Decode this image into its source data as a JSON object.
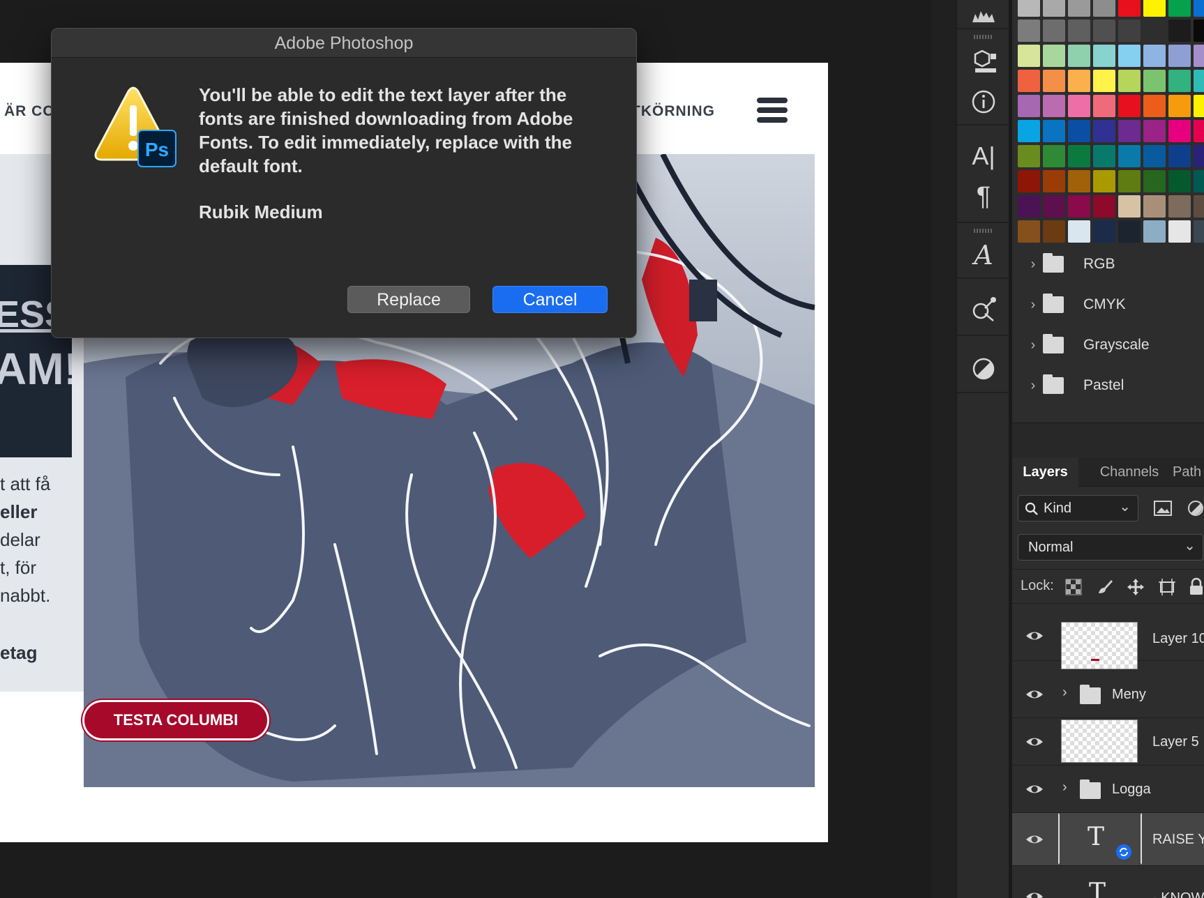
{
  "dialog": {
    "title": "Adobe Photoshop",
    "message": "You'll be able to edit the text layer after the fonts are finished downloading from Adobe Fonts. To edit immediately, replace with the default font.",
    "font_name": "Rubik Medium",
    "replace_label": "Replace",
    "cancel_label": "Cancel",
    "icon_badge": "Ps"
  },
  "document": {
    "nav_left": "ÄR CO",
    "nav_right": "TKÖRNING",
    "banner_line1": "ESS",
    "banner_line2": "AM!",
    "body_lines": [
      "t att få",
      "eller",
      "delar",
      "t, för",
      "nabbt.",
      "etag"
    ],
    "cta_label": "TESTA COLUMBI"
  },
  "swatch_folders": [
    "RGB",
    "CMYK",
    "Grayscale",
    "Pastel"
  ],
  "layers_panel": {
    "tabs": [
      "Layers",
      "Channels",
      "Path"
    ],
    "filter_label": "Kind",
    "blend_mode": "Normal",
    "lock_label": "Lock:",
    "layers": [
      {
        "name": "Layer 10",
        "kind": "pixel"
      },
      {
        "name": "Meny",
        "kind": "group"
      },
      {
        "name": "Layer 5",
        "kind": "pixel"
      },
      {
        "name": "Logga",
        "kind": "group"
      },
      {
        "name": "RAISE Y",
        "kind": "text"
      },
      {
        "name": "- KNOW",
        "kind": "text"
      }
    ]
  },
  "colors": {
    "accent_blue": "#1a6df0",
    "cta_red": "#a6092a",
    "panel_bg": "#2d2d2d"
  },
  "swatches": [
    [
      "#b8b8b8",
      "#a9a9a9",
      "#9a9a9a",
      "#8d8d8d",
      "#e8101d",
      "#fff200",
      "#05a14c",
      "#0a6fd1"
    ],
    [
      "#7c7c7c",
      "#6d6d6d",
      "#5f5f5f",
      "#505050",
      "#404040",
      "#2e2e2e",
      "#1c1c1c",
      "#0a0a0a"
    ],
    [
      "#d6e59a",
      "#a7d79a",
      "#8fd0ad",
      "#88d2cf",
      "#85cff0",
      "#8eb4e3",
      "#8e9fd4",
      "#a48fcb"
    ],
    [
      "#f0623f",
      "#f48f48",
      "#fbb04d",
      "#fff24b",
      "#b6d55b",
      "#7cc36d",
      "#31b27e",
      "#2fbcb8"
    ],
    [
      "#a668b3",
      "#bb6bb0",
      "#ee6fa8",
      "#ef6b7b",
      "#e6101e",
      "#ec5d1a",
      "#f59b0d",
      "#fdf200"
    ],
    [
      "#08a4e3",
      "#0a73c2",
      "#0a4fa3",
      "#303192",
      "#6d2a91",
      "#9b2286",
      "#e6007e",
      "#e5004f"
    ],
    [
      "#6a8c1f",
      "#2e8a34",
      "#0c7a3f",
      "#077a6c",
      "#0a7aa9",
      "#0a5b9d",
      "#0f3f8c",
      "#2a2279"
    ],
    [
      "#8e1607",
      "#9a3c08",
      "#a06208",
      "#a99a00",
      "#5f7c12",
      "#26661f",
      "#06592d",
      "#005a52"
    ],
    [
      "#4b1353",
      "#5e0f4d",
      "#8a0a4c",
      "#8d0a2a",
      "#d7c2a4",
      "#a89078",
      "#7d6b5c",
      "#5d4d40"
    ],
    [
      "#86501c",
      "#6b3c12",
      "#d9e6ef",
      "#1c2b4a",
      "#1c2430",
      "#8cadc4",
      "#e6e6e6",
      "#3b4854"
    ]
  ]
}
